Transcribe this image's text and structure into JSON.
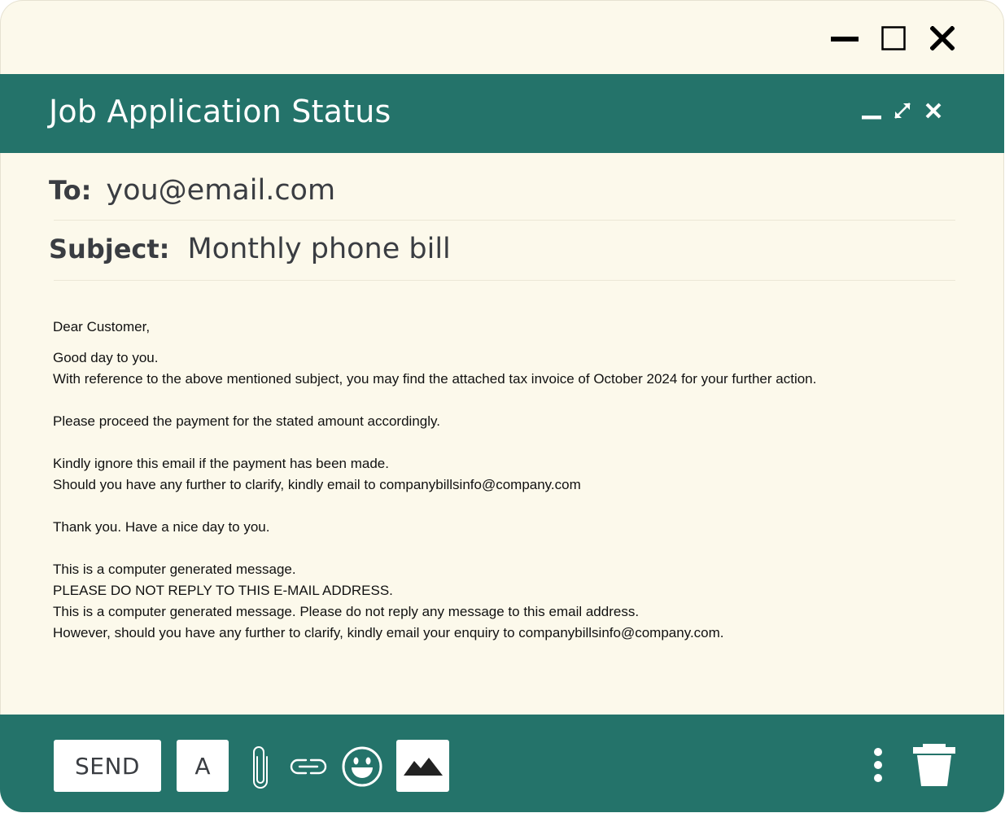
{
  "window": {
    "title": "Job Application Status"
  },
  "compose": {
    "to_label": "To:",
    "to_value": "you@email.com",
    "subject_label": "Subject:",
    "subject_value": "Monthly phone bill"
  },
  "body_lines": {
    "l1": "Dear Customer,",
    "l2": "Good day to you.",
    "l3": "With reference to the above mentioned subject, you may find the attached tax invoice of October 2024 for your further action.",
    "l4": "Please proceed the payment for the stated amount accordingly.",
    "l5": "Kindly ignore this email if the payment has been made.",
    "l6": "Should you have any further to clarify, kindly email to companybillsinfo@company.com",
    "l7": "Thank you. Have a nice day to you.",
    "l8": "This is a computer generated message.",
    "l9": "PLEASE DO NOT REPLY TO THIS E-MAIL ADDRESS.",
    "l10": "This is a computer generated message. Please do not reply any message to this email address.",
    "l11": "However, should you have any further to clarify, kindly email your enquiry to companybillsinfo@company.com."
  },
  "toolbar": {
    "send_label": "SEND",
    "font_label": "A"
  },
  "icons": {
    "os_minimize": "minimize-icon",
    "os_maximize": "maximize-icon",
    "os_close": "close-icon",
    "header_minimize": "minimize-icon",
    "header_expand": "expand-icon",
    "header_close": "close-icon",
    "attach": "paperclip-icon",
    "link": "link-icon",
    "emoji": "smiley-icon",
    "image": "image-icon",
    "more": "more-vertical-icon",
    "trash": "trash-icon"
  },
  "colors": {
    "background": "#fcf9eb",
    "accent": "#24736a",
    "text": "#3a3d42",
    "body_text": "#111111"
  }
}
